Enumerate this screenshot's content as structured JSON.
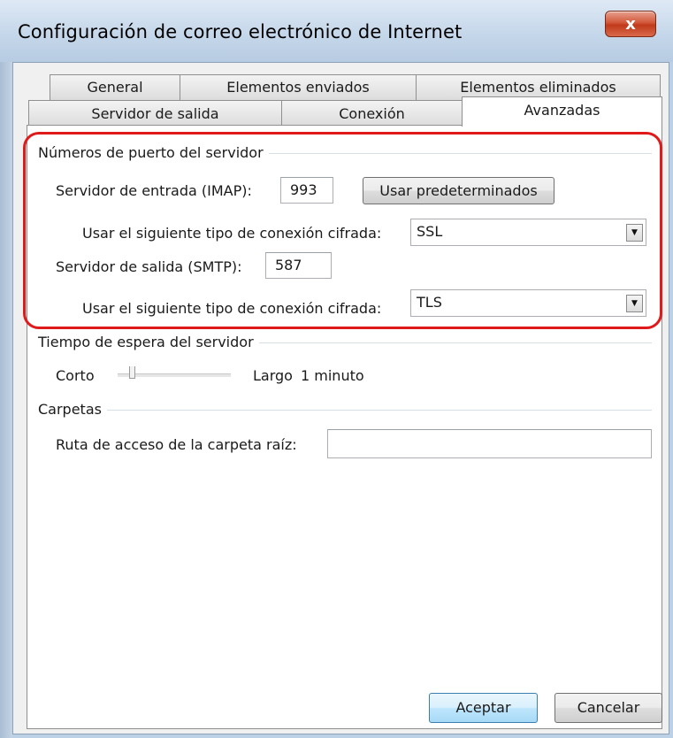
{
  "window": {
    "title": "Configuración de correo electrónico de Internet",
    "close_label": "x"
  },
  "tabs": {
    "row_top": [
      {
        "label": "General"
      },
      {
        "label": "Elementos enviados"
      },
      {
        "label": "Elementos eliminados"
      }
    ],
    "row_bottom": [
      {
        "label": "Servidor de salida"
      },
      {
        "label": "Conexión"
      },
      {
        "label": "Avanzadas",
        "active": true
      }
    ]
  },
  "ports": {
    "group_title": "Números de puerto del servidor",
    "incoming_label": "Servidor de entrada (IMAP):",
    "incoming_value": "993",
    "defaults_button": "Usar predeterminados",
    "incoming_encryption_label": "Usar el siguiente tipo de conexión cifrada:",
    "incoming_encryption_value": "SSL",
    "outgoing_label": "Servidor de salida (SMTP):",
    "outgoing_value": "587",
    "outgoing_encryption_label": "Usar el siguiente tipo de conexión cifrada:",
    "outgoing_encryption_value": "TLS"
  },
  "timeout": {
    "group_title": "Tiempo de espera del servidor",
    "short_label": "Corto",
    "long_label": "Largo",
    "value_label": "1 minuto",
    "slider_level": 0.1
  },
  "folders": {
    "group_title": "Carpetas",
    "root_path_label": "Ruta de acceso de la carpeta raíz:",
    "root_path_value": ""
  },
  "footer": {
    "ok_label": "Aceptar",
    "cancel_label": "Cancelar"
  },
  "colors": {
    "highlight": "#e01a1a",
    "titlebar": "#c5d7ea",
    "panel": "#ffffff"
  }
}
